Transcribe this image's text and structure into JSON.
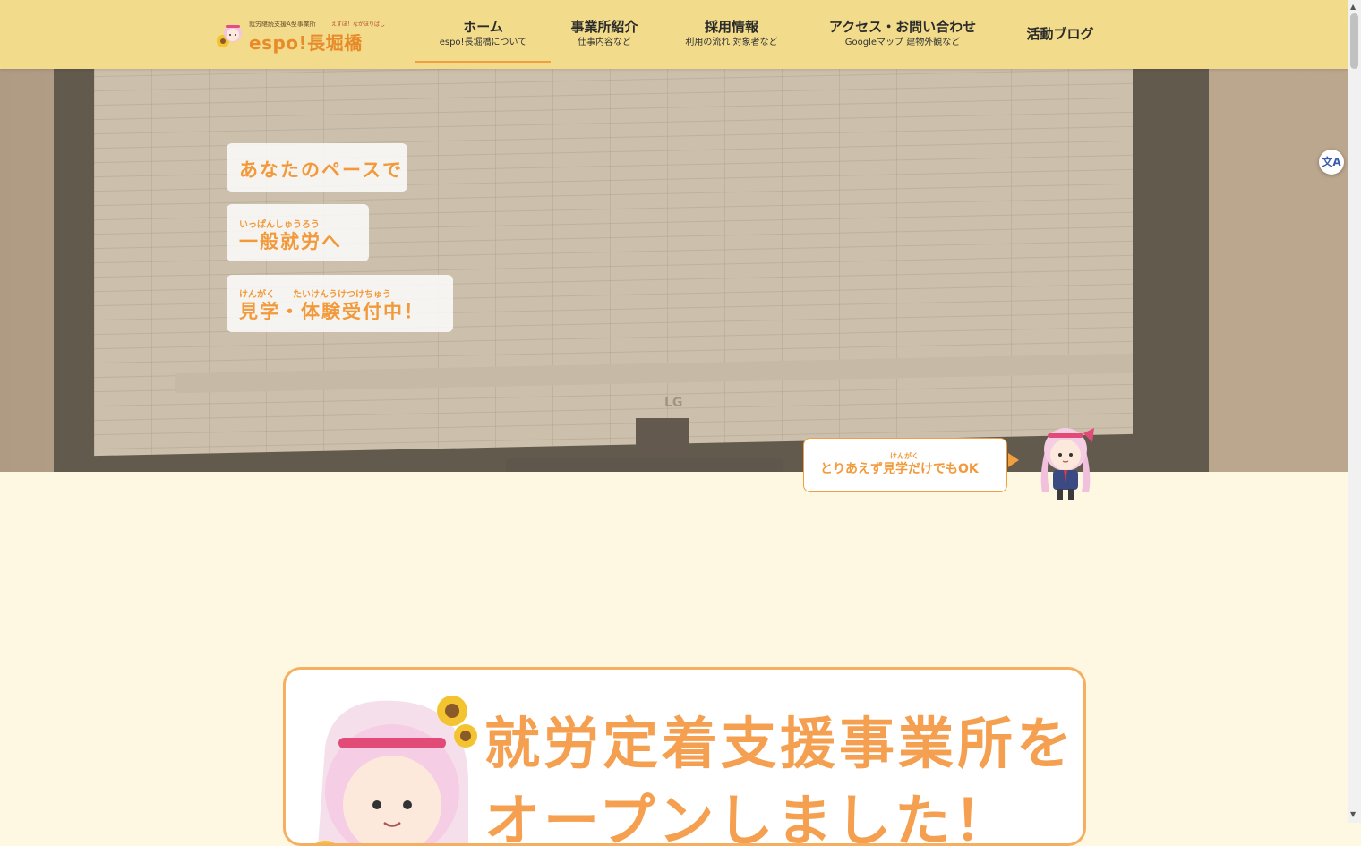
{
  "header": {
    "logo": {
      "tagline": "就労継続支援A型事業所",
      "reading": "えすぽ！ながほりばし",
      "name": "espo!長堀橋"
    },
    "nav": [
      {
        "label": "ホーム",
        "sub": "espo!長堀橋について",
        "active": true
      },
      {
        "label": "事業所紹介",
        "sub": "仕事内容など"
      },
      {
        "label": "採用情報",
        "sub": "利用の流れ 対象者など"
      },
      {
        "label": "アクセス・お問い合わせ",
        "sub": "Googleマップ 建物外観など"
      },
      {
        "label": "活動ブログ",
        "sub": ""
      }
    ]
  },
  "hero": {
    "badges": [
      {
        "ruby": "",
        "text": "あなたのペースで"
      },
      {
        "ruby": "いっぱんしゅうろう",
        "text": "一般就労へ"
      },
      {
        "ruby": "けんがく　　たいけんうけつけちゅう",
        "text": "見学・体験受付中！"
      }
    ],
    "monitor_brand": "LG",
    "cta": {
      "ruby": "けんがく",
      "text": "とりあえず見学だけでもOK"
    }
  },
  "announcement": {
    "text": "就労定着支援事業所をオープンしました！"
  },
  "translate_icon": "translate-icon",
  "colors": {
    "header_bg": "#f2dc8b",
    "accent_orange": "#f29a3b",
    "page_bg": "#fef8e3"
  }
}
